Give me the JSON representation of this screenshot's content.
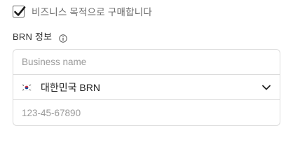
{
  "business_checkbox": {
    "checked": true,
    "label": "비즈니스 목적으로 구매합니다"
  },
  "brn_section": {
    "label": "BRN 정보",
    "info_icon": "info-icon"
  },
  "business_name_input": {
    "placeholder": "Business name",
    "value": ""
  },
  "country_select": {
    "flag_icon": "south-korea-flag-icon",
    "selected": "대한민국 BRN",
    "chevron_icon": "chevron-down-icon"
  },
  "brn_number_input": {
    "placeholder": "123-45-67890",
    "value": ""
  },
  "colors": {
    "border": "#dcdcdc",
    "text": "#222222",
    "placeholder": "#9a9a9a",
    "checkmark": "#1a1a1a"
  }
}
